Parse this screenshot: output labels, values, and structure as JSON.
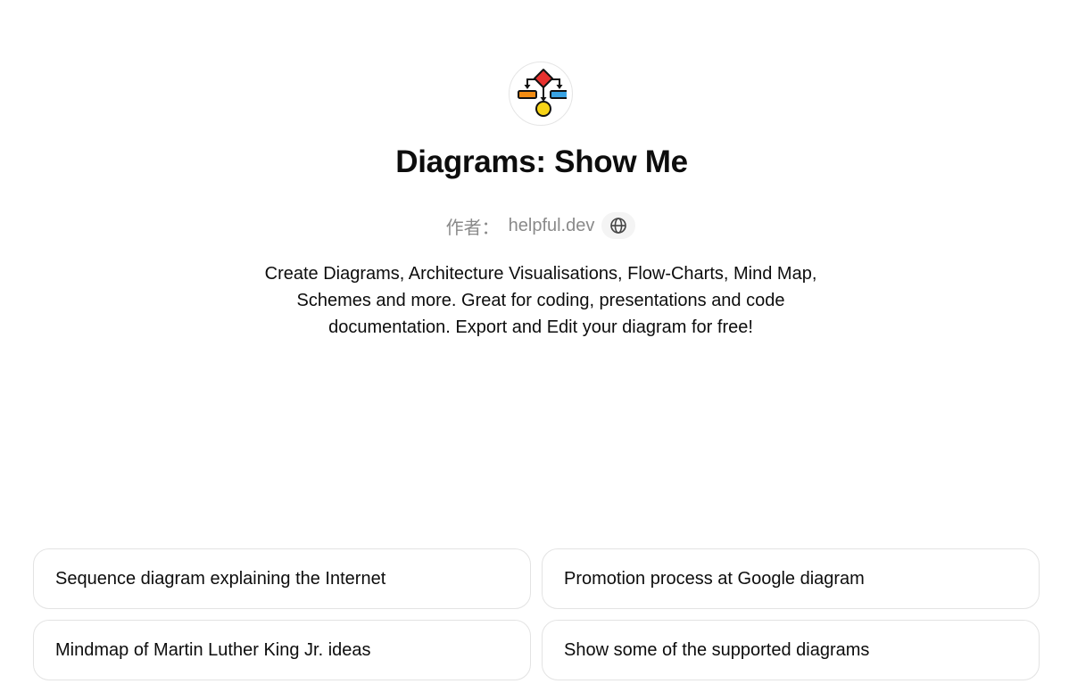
{
  "gpt": {
    "logo_icon": "flowchart-diagram-icon",
    "title": "Diagrams: Show Me",
    "author_prefix": "作者：",
    "author_name": "helpful.dev",
    "website_icon": "globe-icon",
    "description": "Create Diagrams, Architecture Visualisations, Flow-Charts, Mind Map, Schemes and more. Great for coding, presentations and code documentation. Export and Edit your diagram for free!"
  },
  "suggestions": [
    "Sequence diagram explaining the Internet",
    "Promotion process at Google diagram",
    "Mindmap of Martin Luther King Jr. ideas",
    "Show some of the supported diagrams"
  ],
  "colors": {
    "diamond": "#e8312f",
    "left_box": "#f28c13",
    "right_box": "#3aa3e3",
    "circle": "#f7d417",
    "muted_text": "#8a8a8a",
    "border": "#e3e3e3"
  }
}
